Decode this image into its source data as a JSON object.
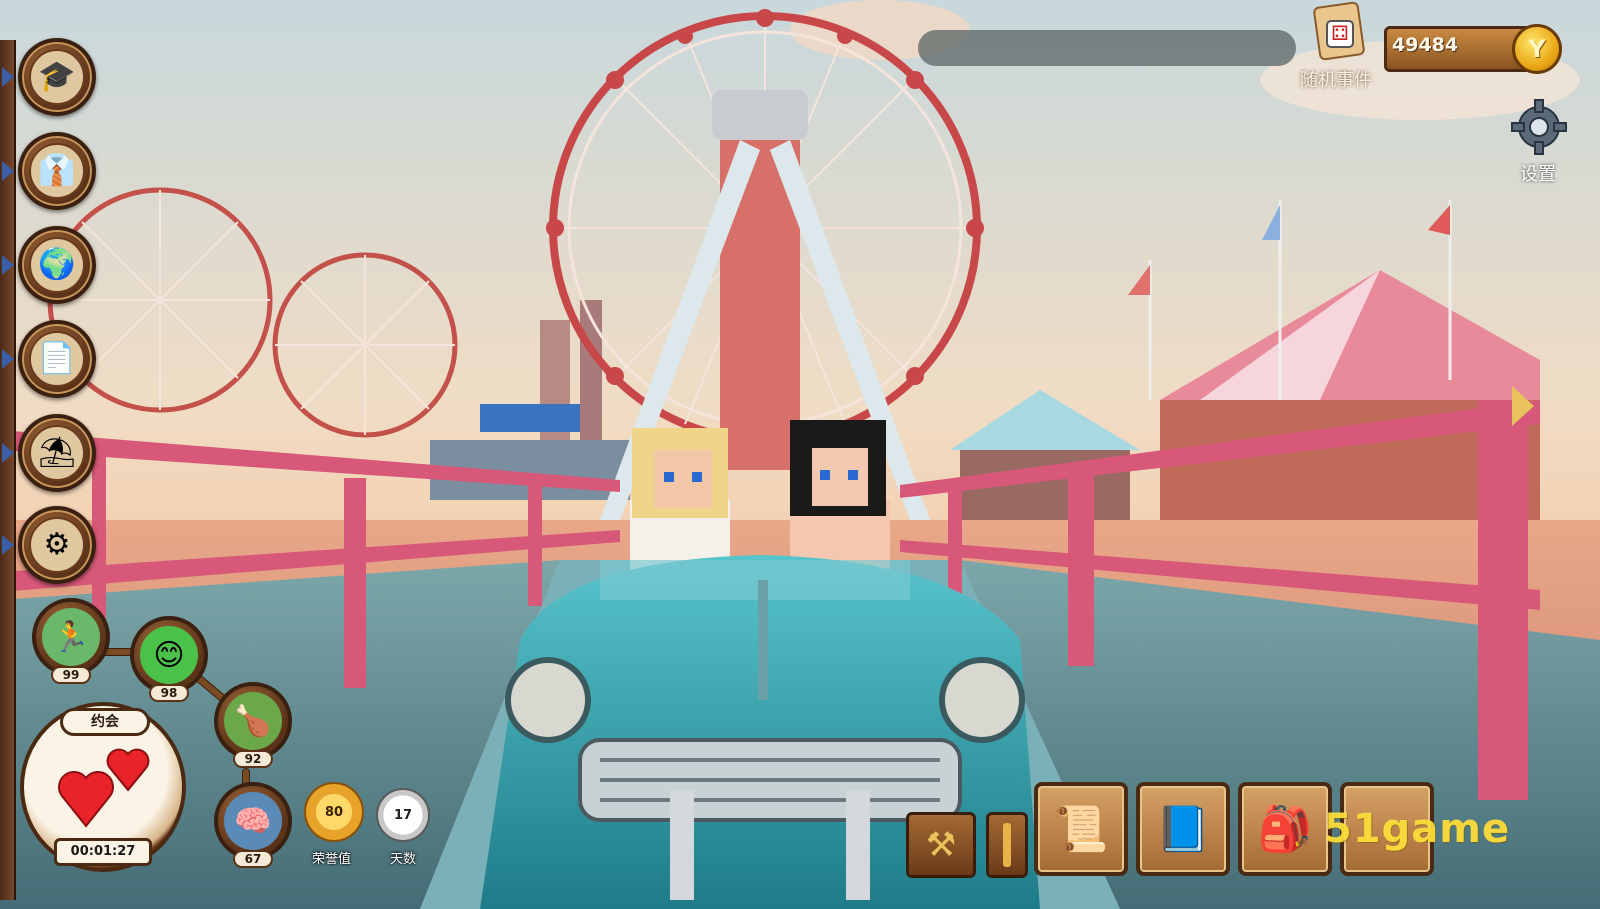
{
  "top_bar": {
    "random_event_label": "随机事件",
    "coins": "49484",
    "coin_symbol": "Y",
    "settings_label": "设置"
  },
  "side_menu": [
    {
      "icon": "graduation-cap-icon",
      "glyph": "🎓"
    },
    {
      "icon": "businessman-icon",
      "glyph": "👔"
    },
    {
      "icon": "globe-icon",
      "glyph": "🌍"
    },
    {
      "icon": "document-icon",
      "glyph": "📄"
    },
    {
      "icon": "beach-umbrella-icon",
      "glyph": "⛱"
    },
    {
      "icon": "wheel-icon",
      "glyph": "⚙"
    }
  ],
  "stats": [
    {
      "name": "stamina",
      "icon": "runner-icon",
      "glyph": "🏃",
      "value": "99"
    },
    {
      "name": "mood",
      "icon": "smile-icon",
      "glyph": "😊",
      "value": "98"
    },
    {
      "name": "hunger",
      "icon": "chicken-icon",
      "glyph": "🍗",
      "value": "92"
    },
    {
      "name": "intellect",
      "icon": "brain-icon",
      "glyph": "🧠",
      "value": "67"
    }
  ],
  "activity": {
    "label": "约会",
    "timer": "00:01:27"
  },
  "honor": {
    "value": "80",
    "label": "荣誉值"
  },
  "days": {
    "value": "17",
    "label": "天数"
  },
  "toolbar": [
    {
      "icon": "hammer-icon",
      "glyph": "⚒"
    },
    {
      "icon": "recipe-scroll-icon",
      "glyph": "📜"
    },
    {
      "icon": "diary-book-icon",
      "glyph": "📘"
    },
    {
      "icon": "backpack-icon",
      "glyph": "🎒"
    }
  ],
  "watermark": "51game",
  "colors": {
    "frame_brown": "#5a3218",
    "gold": "#e8a412",
    "rail_pink": "#d8587a",
    "car_teal": "#3aa8b4"
  }
}
